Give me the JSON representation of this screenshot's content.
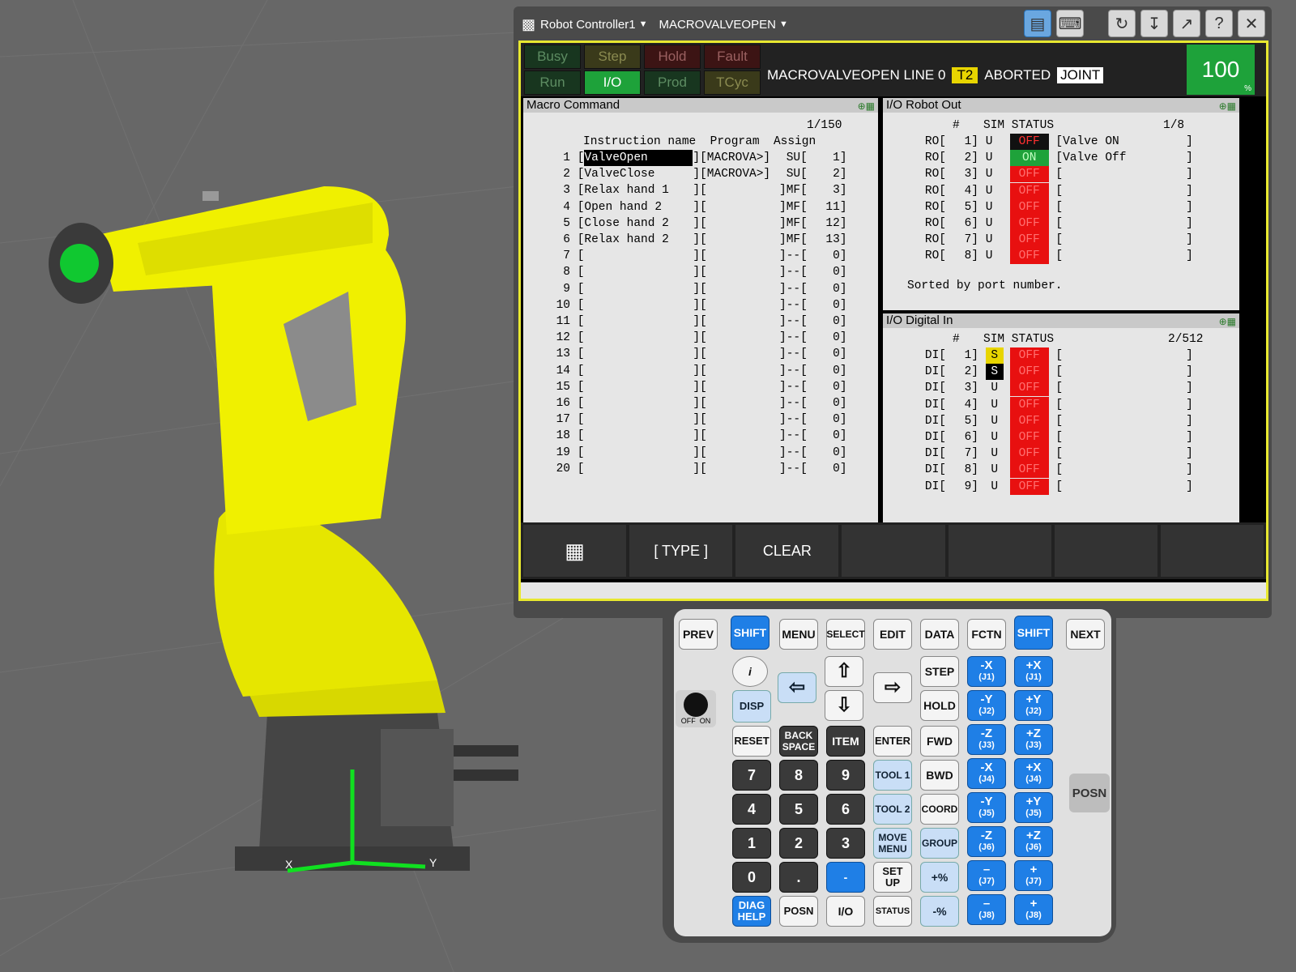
{
  "title_bar": {
    "controller": "Robot Controller1",
    "program": "MACROVALVEOPEN"
  },
  "status": {
    "busy": "Busy",
    "step": "Step",
    "hold": "Hold",
    "fault": "Fault",
    "run": "Run",
    "io": "I/O",
    "prod": "Prod",
    "tcyc": "TCyc",
    "program_line": "MACROVALVEOPEN LINE 0",
    "t2": "T2",
    "state": "ABORTED",
    "coord": "JOINT",
    "override": "100",
    "override_unit": "%"
  },
  "macro_pane": {
    "title": "Macro Command",
    "page": "1/150",
    "header": "Instruction name  Program  Assign",
    "rows": [
      {
        "n": "1",
        "name": "ValveOpen",
        "prog": "[MACROVA>]",
        "type": "SU",
        "assign": "1"
      },
      {
        "n": "2",
        "name": "ValveClose",
        "prog": "[MACROVA>]",
        "type": "SU",
        "assign": "2"
      },
      {
        "n": "3",
        "name": "Relax hand 1",
        "prog": "[",
        "type": "]MF",
        "assign": "3"
      },
      {
        "n": "4",
        "name": "Open hand 2",
        "prog": "[",
        "type": "]MF",
        "assign": "11"
      },
      {
        "n": "5",
        "name": "Close hand 2",
        "prog": "[",
        "type": "]MF",
        "assign": "12"
      },
      {
        "n": "6",
        "name": "Relax hand 2",
        "prog": "[",
        "type": "]MF",
        "assign": "13"
      },
      {
        "n": "7",
        "name": "",
        "prog": "[",
        "type": "]--",
        "assign": "0"
      },
      {
        "n": "8",
        "name": "",
        "prog": "[",
        "type": "]--",
        "assign": "0"
      },
      {
        "n": "9",
        "name": "",
        "prog": "[",
        "type": "]--",
        "assign": "0"
      },
      {
        "n": "10",
        "name": "",
        "prog": "[",
        "type": "]--",
        "assign": "0"
      },
      {
        "n": "11",
        "name": "",
        "prog": "[",
        "type": "]--",
        "assign": "0"
      },
      {
        "n": "12",
        "name": "",
        "prog": "[",
        "type": "]--",
        "assign": "0"
      },
      {
        "n": "13",
        "name": "",
        "prog": "[",
        "type": "]--",
        "assign": "0"
      },
      {
        "n": "14",
        "name": "",
        "prog": "[",
        "type": "]--",
        "assign": "0"
      },
      {
        "n": "15",
        "name": "",
        "prog": "[",
        "type": "]--",
        "assign": "0"
      },
      {
        "n": "16",
        "name": "",
        "prog": "[",
        "type": "]--",
        "assign": "0"
      },
      {
        "n": "17",
        "name": "",
        "prog": "[",
        "type": "]--",
        "assign": "0"
      },
      {
        "n": "18",
        "name": "",
        "prog": "[",
        "type": "]--",
        "assign": "0"
      },
      {
        "n": "19",
        "name": "",
        "prog": "[",
        "type": "]--",
        "assign": "0"
      },
      {
        "n": "20",
        "name": "",
        "prog": "[",
        "type": "]--",
        "assign": "0"
      }
    ]
  },
  "robot_out": {
    "title": "I/O Robot Out",
    "header_num": "#",
    "header": "SIM STATUS",
    "page": "1/8",
    "rows": [
      {
        "label": "RO[",
        "idx": "1]",
        "sim": "U",
        "status": "OFF",
        "comment": "Valve ON"
      },
      {
        "label": "RO[",
        "idx": "2]",
        "sim": "U",
        "status": "ON",
        "comment": "Valve Off"
      },
      {
        "label": "RO[",
        "idx": "3]",
        "sim": "U",
        "status": "OFF",
        "comment": ""
      },
      {
        "label": "RO[",
        "idx": "4]",
        "sim": "U",
        "status": "OFF",
        "comment": ""
      },
      {
        "label": "RO[",
        "idx": "5]",
        "sim": "U",
        "status": "OFF",
        "comment": ""
      },
      {
        "label": "RO[",
        "idx": "6]",
        "sim": "U",
        "status": "OFF",
        "comment": ""
      },
      {
        "label": "RO[",
        "idx": "7]",
        "sim": "U",
        "status": "OFF",
        "comment": ""
      },
      {
        "label": "RO[",
        "idx": "8]",
        "sim": "U",
        "status": "OFF",
        "comment": ""
      }
    ],
    "footer": "Sorted by port number."
  },
  "digital_in": {
    "title": "I/O Digital In",
    "header_num": "#",
    "header": "SIM STATUS",
    "page": "2/512",
    "rows": [
      {
        "label": "DI[",
        "idx": "1]",
        "sim": "S",
        "status": "OFF"
      },
      {
        "label": "DI[",
        "idx": "2]",
        "sim": "S",
        "status": "OFF"
      },
      {
        "label": "DI[",
        "idx": "3]",
        "sim": "U",
        "status": "OFF"
      },
      {
        "label": "DI[",
        "idx": "4]",
        "sim": "U",
        "status": "OFF"
      },
      {
        "label": "DI[",
        "idx": "5]",
        "sim": "U",
        "status": "OFF"
      },
      {
        "label": "DI[",
        "idx": "6]",
        "sim": "U",
        "status": "OFF"
      },
      {
        "label": "DI[",
        "idx": "7]",
        "sim": "U",
        "status": "OFF"
      },
      {
        "label": "DI[",
        "idx": "8]",
        "sim": "U",
        "status": "OFF"
      },
      {
        "label": "DI[",
        "idx": "9]",
        "sim": "U",
        "status": "OFF"
      }
    ]
  },
  "softkeys": {
    "grid_icon": "grid-icon",
    "type": "[ TYPE ]",
    "clear": "CLEAR"
  },
  "keypad": {
    "prev": "PREV",
    "shift": "SHIFT",
    "menu": "MENU",
    "select": "SELECT",
    "edit": "EDIT",
    "data": "DATA",
    "fctn": "FCTN",
    "next": "NEXT",
    "info": "i",
    "disp": "DISP",
    "step": "STEP",
    "hold": "HOLD",
    "fwd": "FWD",
    "bwd": "BWD",
    "coord": "COORD",
    "group": "GROUP",
    "reset": "RESET",
    "backspace": "BACK SPACE",
    "item": "ITEM",
    "enter": "ENTER",
    "tool1": "TOOL 1",
    "tool2": "TOOL 2",
    "move_menu": "MOVE MENU",
    "setup": "SET UP",
    "digits": [
      "7",
      "8",
      "9",
      "4",
      "5",
      "6",
      "1",
      "2",
      "3",
      "0",
      "."
    ],
    "minus": "-",
    "diag_help": "DIAG HELP",
    "posn": "POSN",
    "io": "I/O",
    "status": "STATUS",
    "plus_pct": "+%",
    "minus_pct": "-%",
    "jog_neg": [
      "-X",
      "-Y",
      "-Z",
      "-X",
      "-Y",
      "-Z",
      "–",
      "–"
    ],
    "jog_pos": [
      "+X",
      "+Y",
      "+Z",
      "+X",
      "+Y",
      "+Z",
      "+",
      "+"
    ],
    "jog_sub": [
      "(J1)",
      "(J2)",
      "(J3)",
      "(J4)",
      "(J5)",
      "(J6)",
      "(J7)",
      "(J8)"
    ],
    "off": "OFF",
    "on": "ON",
    "posn_side": "POSN"
  },
  "axes": {
    "x": "X",
    "y": "Y"
  },
  "colors": {
    "robot": "#f0f000",
    "screen_border": "#e8e830",
    "off_red": "#e81010",
    "on_green": "#1ea23a"
  }
}
